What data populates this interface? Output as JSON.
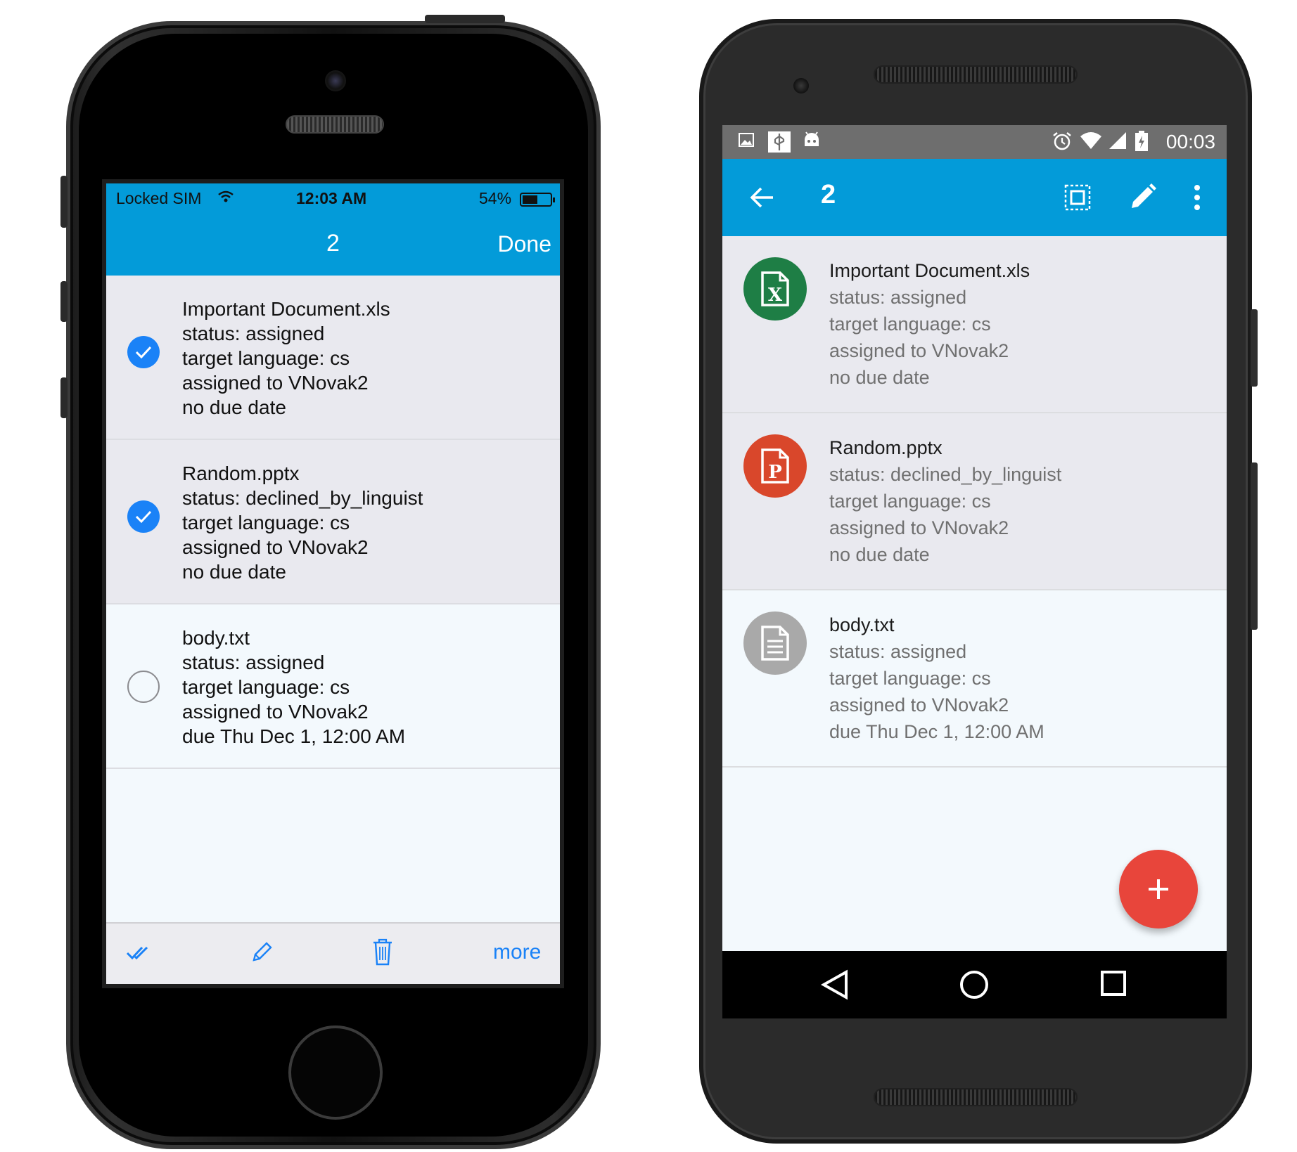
{
  "ios": {
    "status": {
      "carrier": "Locked SIM",
      "time": "12:03 AM",
      "battery": "54%",
      "wifi_icon": "wifi-icon",
      "battery_level": 0.54
    },
    "nav": {
      "title": "2",
      "done": "Done"
    },
    "items": [
      {
        "lines": [
          "Important Document.xls",
          "status: assigned",
          "target language: cs",
          "assigned to VNovak2",
          "no due date"
        ],
        "selected": true
      },
      {
        "lines": [
          "Random.pptx",
          "status: declined_by_linguist",
          "target language: cs",
          "assigned to VNovak2",
          "no due date"
        ],
        "selected": true
      },
      {
        "lines": [
          "body.txt",
          "status: assigned",
          "target language: cs",
          "assigned to VNovak2",
          "due Thu Dec 1, 12:00 AM"
        ],
        "selected": false
      }
    ],
    "toolbar": {
      "icons": [
        "double-check-icon",
        "pencil-icon",
        "trash-icon"
      ],
      "more": "more"
    }
  },
  "android": {
    "status": {
      "icons": [
        "image-icon",
        "usb-icon",
        "android-debug-icon",
        "alarm-icon",
        "wifi-icon",
        "signal-icon",
        "battery-charging-icon"
      ],
      "time": "00:03"
    },
    "appbar": {
      "count": "2",
      "icons": [
        "back-arrow-icon",
        "select-all-icon",
        "edit-icon",
        "more-vert-icon"
      ]
    },
    "items": [
      {
        "name": "Important Document.xls",
        "details": [
          "status: assigned",
          "target language: cs",
          "assigned to VNovak2",
          "no due date"
        ],
        "icon": "excel-file-icon",
        "icon_color": "#1e7e45",
        "selected": true
      },
      {
        "name": "Random.pptx",
        "details": [
          "status: declined_by_linguist",
          "target language: cs",
          "assigned to VNovak2",
          "no due date"
        ],
        "icon": "powerpoint-file-icon",
        "icon_color": "#d9472b",
        "selected": true
      },
      {
        "name": "body.txt",
        "details": [
          "status: assigned",
          "target language: cs",
          "assigned to VNovak2",
          "due Thu Dec 1, 12:00 AM"
        ],
        "icon": "text-file-icon",
        "icon_color": "#a9a9a9",
        "selected": false
      }
    ],
    "fab_icon": "plus-icon",
    "navbar": [
      "back-triangle-icon",
      "home-circle-icon",
      "recents-square-icon"
    ]
  },
  "colors": {
    "accent": "#039bd9",
    "ios_tint": "#1a82f7",
    "fab": "#e8453b"
  }
}
